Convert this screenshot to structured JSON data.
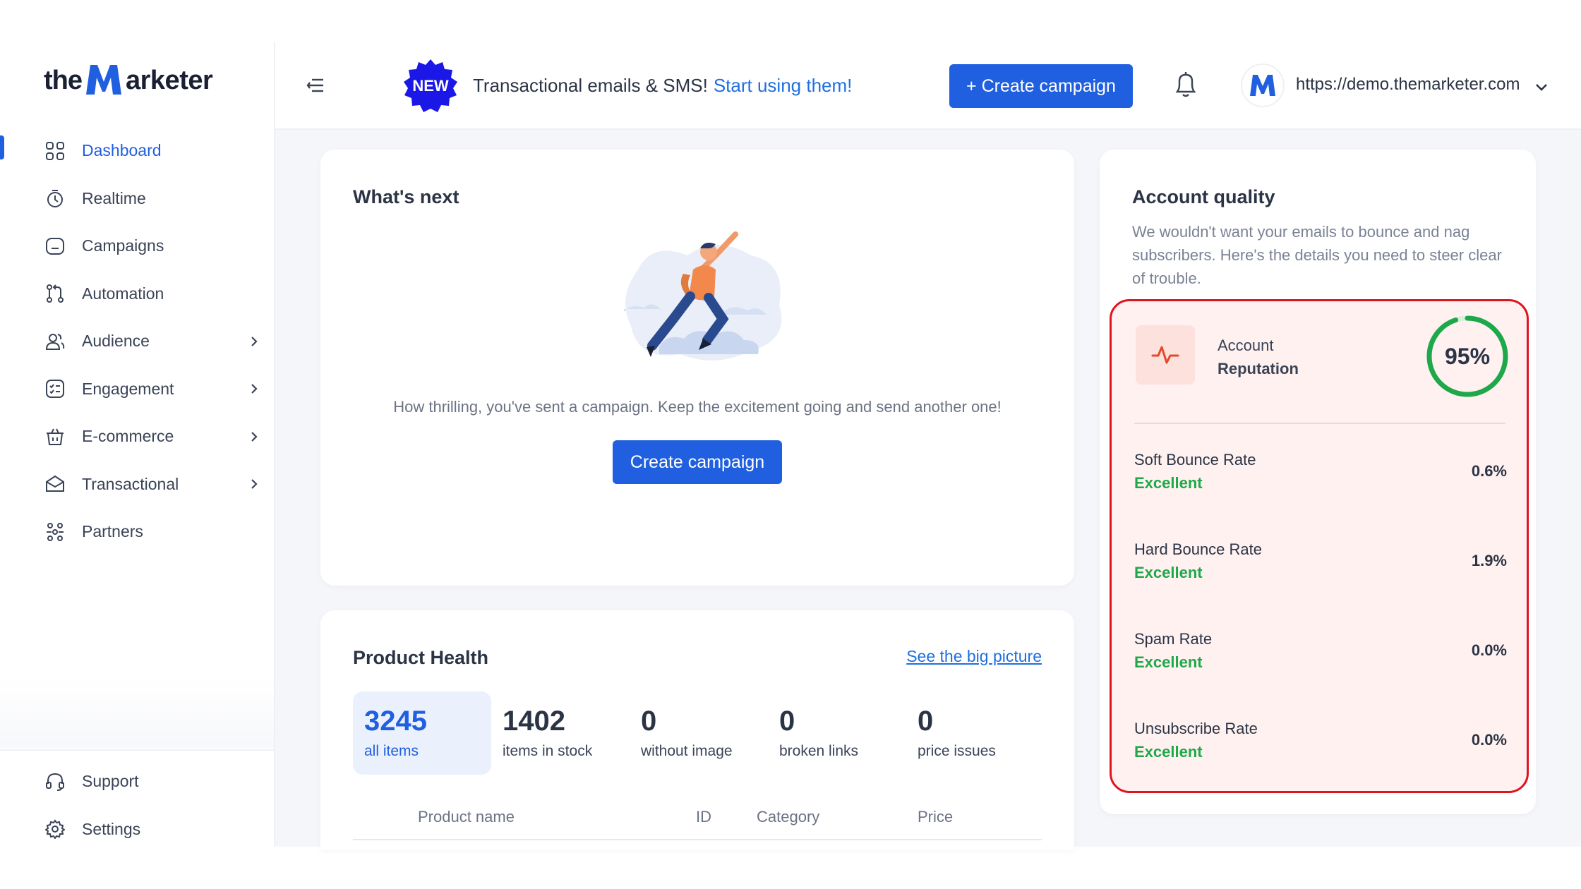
{
  "brand": {
    "logo_the": "the",
    "logo_rest": "arketer"
  },
  "sidebar": {
    "items": [
      {
        "label": "Dashboard",
        "active": true
      },
      {
        "label": "Realtime"
      },
      {
        "label": "Campaigns"
      },
      {
        "label": "Automation"
      },
      {
        "label": "Audience",
        "has_submenu": true
      },
      {
        "label": "Engagement",
        "has_submenu": true
      },
      {
        "label": "E-commerce",
        "has_submenu": true
      },
      {
        "label": "Transactional",
        "has_submenu": true
      },
      {
        "label": "Partners"
      }
    ],
    "bottom_items": [
      {
        "label": "Support"
      },
      {
        "label": "Settings"
      }
    ]
  },
  "header": {
    "badge": "NEW",
    "promo_text": "Transactional emails & SMS!",
    "promo_link": "Start using them!",
    "create_button": "+ Create campaign",
    "account_url": "https://demo.themarketer.com"
  },
  "whats_next": {
    "title": "What's next",
    "message": "How thrilling, you've sent a campaign. Keep the excitement going and send another one!",
    "button": "Create campaign"
  },
  "product_health": {
    "title": "Product Health",
    "link": "See the big picture",
    "stats": [
      {
        "value": "3245",
        "label": "all items",
        "active": true
      },
      {
        "value": "1402",
        "label": "items in stock"
      },
      {
        "value": "0",
        "label": "without image"
      },
      {
        "value": "0",
        "label": "broken links"
      },
      {
        "value": "0",
        "label": "price issues"
      }
    ],
    "columns": [
      "Product name",
      "ID",
      "Category",
      "Price"
    ]
  },
  "account_quality": {
    "title": "Account quality",
    "description": "We wouldn't want your emails to bounce and nag subscribers. Here's the details you need to steer clear of trouble.",
    "reputation_label_1": "Account",
    "reputation_label_2": "Reputation",
    "reputation_value": "95%",
    "reputation_fraction": 0.95,
    "metrics": [
      {
        "name": "Soft Bounce Rate",
        "status": "Excellent",
        "value": "0.6%"
      },
      {
        "name": "Hard Bounce Rate",
        "status": "Excellent",
        "value": "1.9%"
      },
      {
        "name": "Spam Rate",
        "status": "Excellent",
        "value": "0.0%"
      },
      {
        "name": "Unsubscribe Rate",
        "status": "Excellent",
        "value": "0.0%"
      }
    ]
  },
  "colors": {
    "primary": "#1f5fe0",
    "success": "#1ea84a",
    "alert_border": "#e0141f",
    "alert_bg": "#fff1f0"
  }
}
